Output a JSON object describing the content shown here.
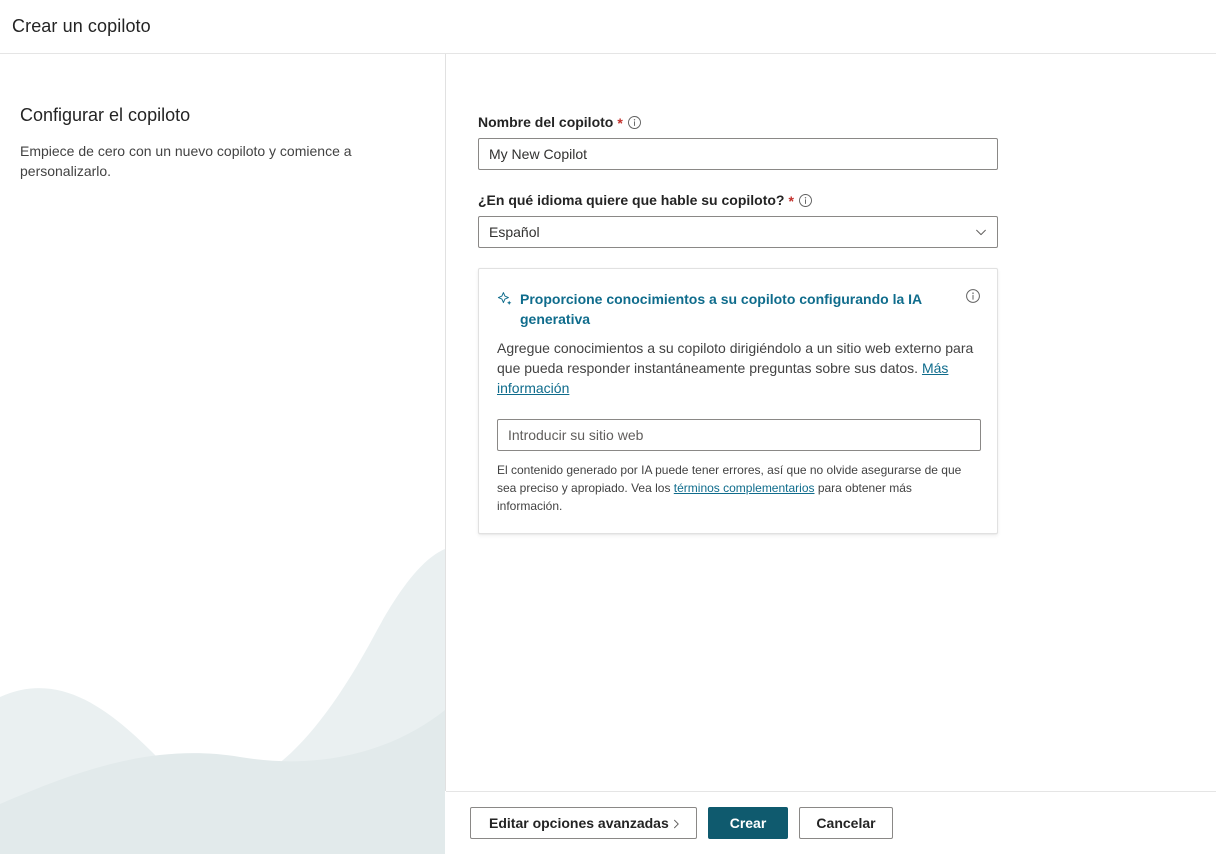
{
  "header": {
    "title": "Crear un copiloto"
  },
  "left_pane": {
    "heading": "Configurar el copiloto",
    "description": "Empiece de cero con un nuevo copiloto y comience a personalizarlo."
  },
  "form": {
    "name_field": {
      "label": "Nombre del copiloto",
      "required_marker": "*",
      "info_icon": "info-icon",
      "value": "My New Copilot",
      "placeholder": "My New Copilot"
    },
    "language_field": {
      "label": "¿En qué idioma quiere que hable su copiloto?",
      "required_marker": "*",
      "info_icon": "info-icon",
      "selected": "Español",
      "chevron_icon": "chevron-down-icon"
    },
    "generative_ai_card": {
      "sparkle_icon": "sparkle-icon",
      "info_icon": "info-icon",
      "title": "Proporcione conocimientos a su copiloto configurando la IA generativa",
      "body_text_1": "Agregue conocimientos a su copiloto dirigiéndolo a un sitio web externo para que pueda responder instantáneamente preguntas sobre sus datos. ",
      "body_link": "Más información",
      "website_placeholder": "Introducir su sitio web",
      "website_value": "",
      "disclaimer_1": "El contenido generado por IA puede tener errores, así que no olvide asegurarse de que sea preciso y apropiado. Vea los ",
      "disclaimer_link": "términos complementarios",
      "disclaimer_2": " para obtener más información."
    }
  },
  "footer": {
    "advanced_button": "Editar opciones avanzadas",
    "advanced_chevron": "chevron-right-icon",
    "create_button": "Crear",
    "cancel_button": "Cancelar"
  },
  "colors": {
    "accent_teal": "#0f6c8c",
    "primary_button": "#0f5a6e",
    "required_red": "#c2302b",
    "wave_light": "#eef3f4",
    "wave_dark": "#e3ebec",
    "border_gray": "#e1e1e1"
  }
}
